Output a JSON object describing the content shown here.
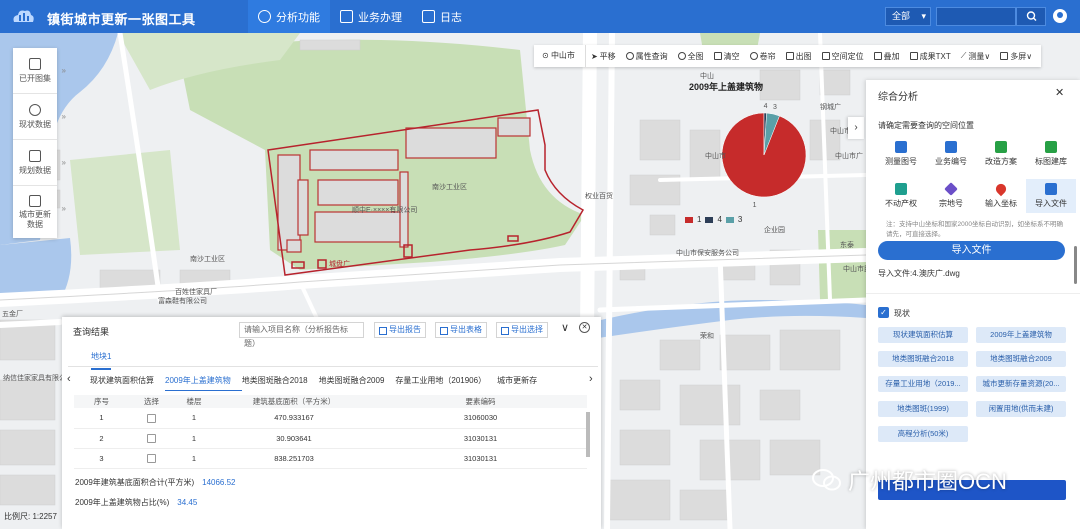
{
  "app": {
    "title": "镇街城市更新一张图工具"
  },
  "nav": {
    "analysis": "分析功能",
    "business": "业务办理",
    "log": "日志"
  },
  "header_search": {
    "scope": "全部",
    "placeholder": ""
  },
  "left_rail": [
    {
      "label": "已开图集"
    },
    {
      "label": "现状数据"
    },
    {
      "label": "规划数据"
    },
    {
      "label": "城市更新数据"
    }
  ],
  "toolbar": {
    "city": "中山市",
    "items": [
      "平移",
      "属性查询",
      "全图",
      "清空",
      "卷帘",
      "出图",
      "空间定位",
      "叠加",
      "成果TXT",
      "测量∨",
      "多屏∨"
    ]
  },
  "map_labels": {
    "park": "南沙工业区",
    "company": "顺中E·××××有限公司",
    "park2": "南沙工业区",
    "road_sign": "城盘广",
    "company2": "富森鞋有限公司",
    "farm": "百姓佳家具厂",
    "furniture": "纳信佳家家具有限公司",
    "wuzhi": "五金厂",
    "admin": "中山市",
    "media": "中山市广",
    "security": "中山市保安服务公司",
    "enterprise": "企业园",
    "steel": "钢城广",
    "zhongshan2": "中山市",
    "power": "权业百货",
    "ronghe": "荣和",
    "minzu": "中山市民之",
    "enter2": "东泰",
    "yuejie": "中山"
  },
  "chart_data": {
    "type": "pie",
    "title": "2009年上盖建筑物",
    "categories": [
      "1",
      "4",
      "3"
    ],
    "values": [
      94,
      1,
      5
    ],
    "colors": [
      "#c62b2b",
      "#2d3e57",
      "#5aa0a8"
    ]
  },
  "right_panel": {
    "title": "综合分析",
    "hint": "请确定需要查询的空间位置",
    "tools": [
      {
        "label": "测量图号",
        "color": "#2a6fd0"
      },
      {
        "label": "业务编号",
        "color": "#2a6fd0"
      },
      {
        "label": "改造方案",
        "color": "#27a045"
      },
      {
        "label": "标图建库",
        "color": "#27a045"
      },
      {
        "label": "不动产权",
        "color": "#1f9f8f"
      },
      {
        "label": "宗地号",
        "color": "#6b4fc8"
      },
      {
        "label": "输入坐标",
        "color": "#d9362b"
      },
      {
        "label": "导入文件",
        "color": "#2a6fd0"
      }
    ],
    "note": "注：支持中山坐标和国家2000坐标自动识别，如坐标系不明确请先，可直接选择。",
    "import_button": "导入文件",
    "import_file": "导入文件:4.澳庆广.dwg",
    "status_label": "现状",
    "tags": [
      "现状建筑面积估算",
      "2009年上盖建筑物",
      "地类图斑融合2018",
      "地类图斑融合2009",
      "存量工业用地（2019...",
      "城市更新存量资源(20...",
      "地类图斑(1999)",
      "闲置用地(供而未建)",
      "高程分析(50米)"
    ]
  },
  "query_panel": {
    "title": "查询结果",
    "input_placeholder": "请输入项目名称（分析报告标题）",
    "export_report": "导出报告",
    "export_table": "导出表格",
    "export_selected": "导出选择",
    "layer_tab": "地块1",
    "subtabs": [
      "现状建筑面积估算",
      "2009年上盖建筑物",
      "地类图斑融合2018",
      "地类图斑融合2009",
      "存量工业用地（201906）",
      "城市更新存"
    ],
    "columns": [
      "序号",
      "选择",
      "楼层",
      "建筑基底面积（平方米）",
      "要素编码"
    ],
    "rows": [
      [
        "1",
        "",
        "1",
        "470.933167",
        "31060030"
      ],
      [
        "2",
        "",
        "1",
        "30.903641",
        "31030131"
      ],
      [
        "3",
        "",
        "1",
        "838.251703",
        "31030131"
      ]
    ],
    "sum_area_label": "2009年建筑基底面积合计(平方米)",
    "sum_area_value": "14066.52",
    "ratio_label": "2009年上盖建筑物占比(%)",
    "ratio_value": "34.45"
  },
  "scale_text": "比例尺: 1:2257",
  "watermark": "广州都市圈OCN"
}
